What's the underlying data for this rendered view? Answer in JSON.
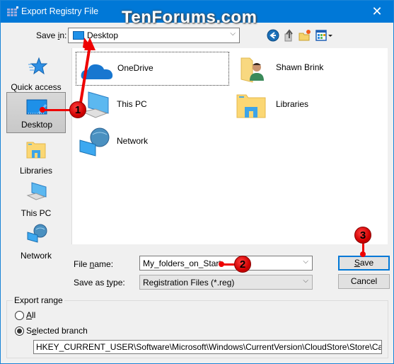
{
  "window": {
    "title": "Export Registry File",
    "watermark": "TenForums.com",
    "close_glyph": "✕"
  },
  "save_in": {
    "label": "Save in:",
    "value": "Desktop",
    "chevron": "⌵"
  },
  "toolbar": {
    "icons": [
      "back-icon",
      "up-folder-icon",
      "new-folder-icon",
      "view-menu-icon"
    ]
  },
  "places": [
    {
      "label": "Quick access",
      "icon": "star-icon"
    },
    {
      "label": "Desktop",
      "icon": "desktop-icon",
      "selected": true
    },
    {
      "label": "Libraries",
      "icon": "libraries-icon"
    },
    {
      "label": "This PC",
      "icon": "pc-icon"
    },
    {
      "label": "Network",
      "icon": "network-icon"
    }
  ],
  "items": [
    {
      "label": "OneDrive",
      "icon": "onedrive-icon"
    },
    {
      "label": "Shawn Brink",
      "icon": "user-folder-icon"
    },
    {
      "label": "This PC",
      "icon": "pc-icon"
    },
    {
      "label": "Libraries",
      "icon": "libraries-icon"
    },
    {
      "label": "Network",
      "icon": "network-icon"
    }
  ],
  "file_name": {
    "label_pre": "File ",
    "label_u": "n",
    "label_post": "ame:",
    "value": "My_folders_on_Start"
  },
  "save_type": {
    "label_pre": "Save as ",
    "label_u": "t",
    "label_post": "ype:",
    "value": "Registration Files (*.reg)"
  },
  "buttons": {
    "save_u": "S",
    "save_rest": "ave",
    "cancel": "Cancel"
  },
  "export_range": {
    "legend": "Export range",
    "all_u": "A",
    "all_rest": "ll",
    "selected_pre": "S",
    "selected_u": "e",
    "selected_post": "lected branch",
    "branch_value": "HKEY_CURRENT_USER\\Software\\Microsoft\\Windows\\CurrentVersion\\CloudStore\\Store\\Cache\\Def",
    "selected_option": "selected_branch"
  },
  "annotations": [
    "1",
    "2",
    "3"
  ],
  "colors": {
    "accent": "#0078d7",
    "annotation": "#e00000"
  }
}
